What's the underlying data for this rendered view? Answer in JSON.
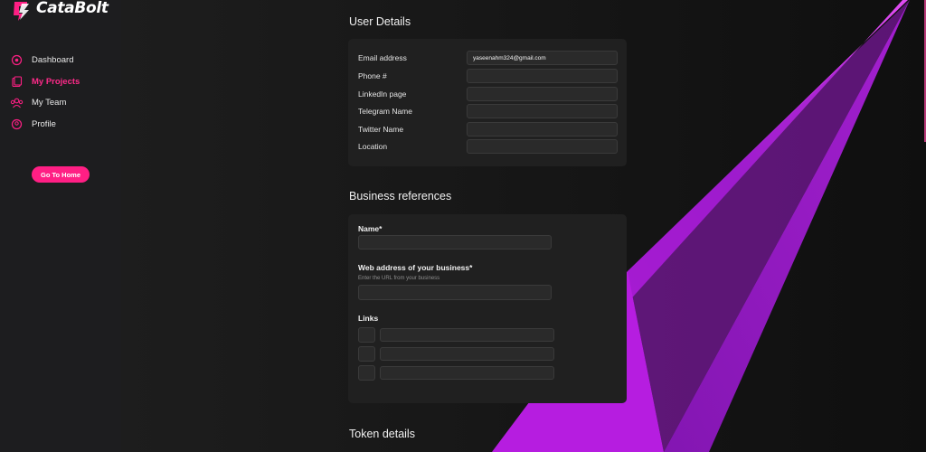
{
  "app": {
    "name": "CataBolt"
  },
  "sidebar": {
    "items": [
      {
        "label": "Dashboard",
        "icon": "dashboard-icon",
        "active": false
      },
      {
        "label": "My Projects",
        "icon": "projects-icon",
        "active": true
      },
      {
        "label": "My Team",
        "icon": "team-icon",
        "active": false
      },
      {
        "label": "Profile",
        "icon": "profile-icon",
        "active": false
      }
    ],
    "home_button": "Go To Home"
  },
  "user_details": {
    "title": "User Details",
    "fields": [
      {
        "label": "Email address",
        "value": "yaseenahm324@gmail.com"
      },
      {
        "label": "Phone #",
        "value": ""
      },
      {
        "label": "LinkedIn page",
        "value": ""
      },
      {
        "label": "Telegram Name",
        "value": ""
      },
      {
        "label": "Twitter Name",
        "value": ""
      },
      {
        "label": "Location",
        "value": ""
      }
    ]
  },
  "business_references": {
    "title": "Business references",
    "name_label": "Name*",
    "name_value": "",
    "web_label": "Web address of your business*",
    "web_hint": "Enter the URL from your business",
    "web_value": "",
    "links_label": "Links",
    "links": [
      "",
      "",
      ""
    ]
  },
  "token_details": {
    "title": "Token details"
  },
  "colors": {
    "accent": "#ff1f84",
    "background": "#151515",
    "card": "#202020",
    "purple": "#b41ee0"
  }
}
